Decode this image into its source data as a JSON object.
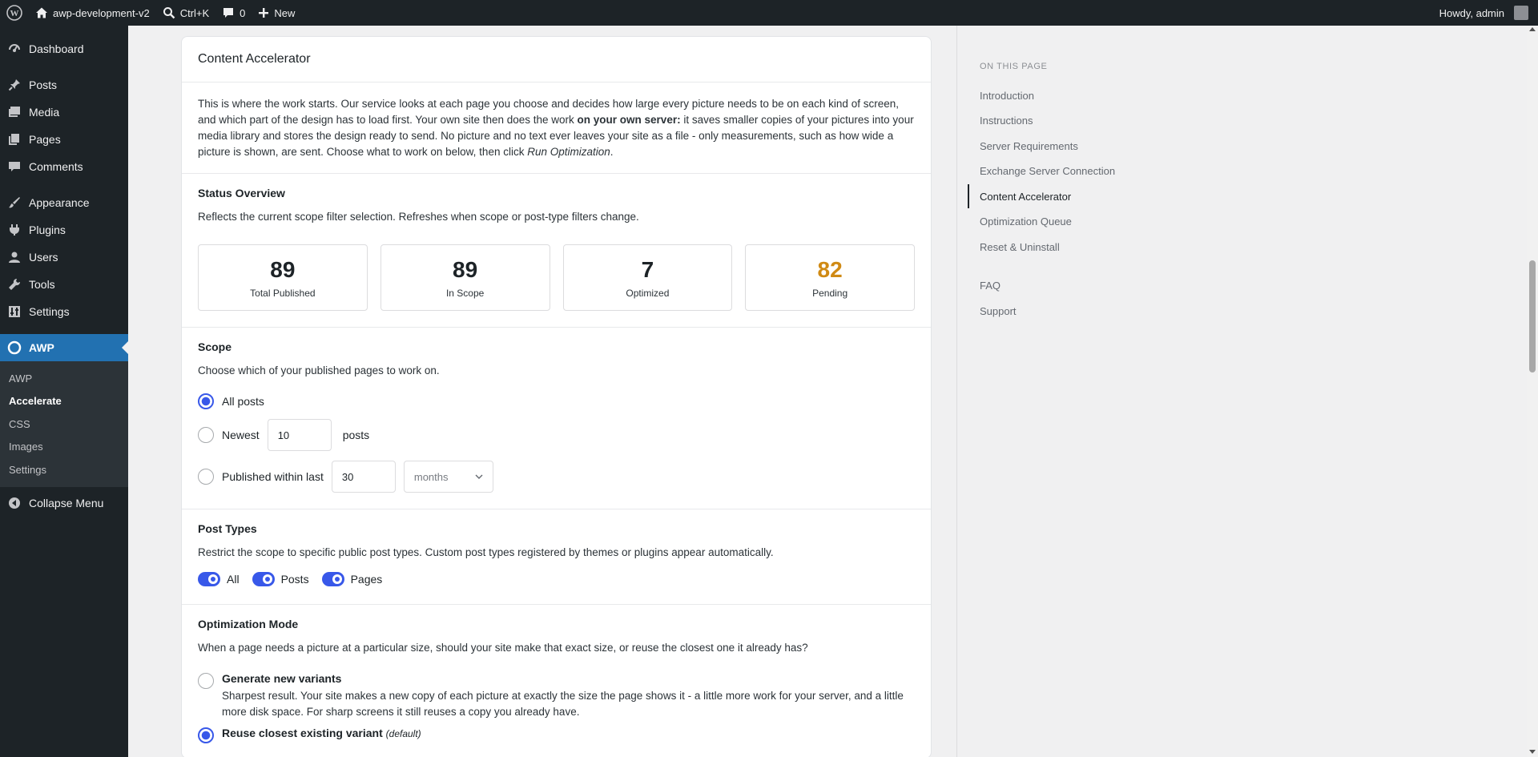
{
  "adminbar": {
    "site_name": "awp-development-v2",
    "search_shortcut": "Ctrl+K",
    "comments_count": "0",
    "new_label": "New",
    "greeting": "Howdy, admin"
  },
  "sidebar": {
    "items": [
      {
        "label": "Dashboard",
        "icon": "dashboard-icon"
      },
      {
        "label": "Posts",
        "icon": "pin-icon"
      },
      {
        "label": "Media",
        "icon": "media-icon"
      },
      {
        "label": "Pages",
        "icon": "pages-icon"
      },
      {
        "label": "Comments",
        "icon": "comment-icon"
      },
      {
        "label": "Appearance",
        "icon": "brush-icon"
      },
      {
        "label": "Plugins",
        "icon": "plugin-icon"
      },
      {
        "label": "Users",
        "icon": "user-icon"
      },
      {
        "label": "Tools",
        "icon": "wrench-icon"
      },
      {
        "label": "Settings",
        "icon": "settings-icon"
      }
    ],
    "active": {
      "label": "AWP",
      "icon": "awp-icon"
    },
    "submenu": [
      "AWP",
      "Accelerate",
      "CSS",
      "Images",
      "Settings"
    ],
    "collapse": "Collapse Menu"
  },
  "card": {
    "title": "Content Accelerator",
    "intro_part1": "This is where the work starts. Our service looks at each page you choose and decides how large every picture needs to be on each kind of screen, and which part of the design has to load first. Your own site then does the work ",
    "intro_bold": "on your own server:",
    "intro_part2": " it saves smaller copies of your pictures into your media library and stores the design ready to send. No picture and no text ever leaves your site as a file - only measurements, such as how wide a picture is shown, are sent. Choose what to work on below, then click ",
    "intro_italic": "Run Optimization",
    "intro_end": "."
  },
  "status": {
    "title": "Status Overview",
    "desc": "Reflects the current scope filter selection. Refreshes when scope or post-type filters change.",
    "stats": [
      {
        "value": "89",
        "label": "Total Published"
      },
      {
        "value": "89",
        "label": "In Scope"
      },
      {
        "value": "7",
        "label": "Optimized"
      },
      {
        "value": "82",
        "label": "Pending"
      }
    ],
    "pending_color": "#d08a14"
  },
  "scope": {
    "title": "Scope",
    "desc": "Choose which of your published pages to work on.",
    "all_posts": "All posts",
    "newest": "Newest",
    "newest_value": "10",
    "posts_suffix": "posts",
    "within": "Published within last",
    "within_value": "30",
    "unit": "months"
  },
  "post_types": {
    "title": "Post Types",
    "desc": "Restrict the scope to specific public post types. Custom post types registered by themes or plugins appear automatically.",
    "toggles": [
      "All",
      "Posts",
      "Pages"
    ]
  },
  "mode": {
    "title": "Optimization Mode",
    "desc": "When a page needs a picture at a particular size, should your site make that exact size, or reuse the closest one it already has?",
    "opt1_title": "Generate new variants",
    "opt1_desc": "Sharpest result. Your site makes a new copy of each picture at exactly the size the page shows it - a little more work for your server, and a little more disk space. For sharp screens it still reuses a copy you already have.",
    "opt2_title": "Reuse closest existing variant",
    "opt2_tag": "(default)"
  },
  "toc": {
    "heading": "On this page",
    "items": [
      "Introduction",
      "Instructions",
      "Server Requirements",
      "Exchange Server Connection",
      "Content Accelerator",
      "Optimization Queue",
      "Reset & Uninstall"
    ],
    "extra": [
      "FAQ",
      "Support"
    ],
    "current": "Content Accelerator"
  },
  "colors": {
    "accent": "#3858e9",
    "admin_blue": "#2271b1",
    "admin_dark": "#1d2327"
  }
}
